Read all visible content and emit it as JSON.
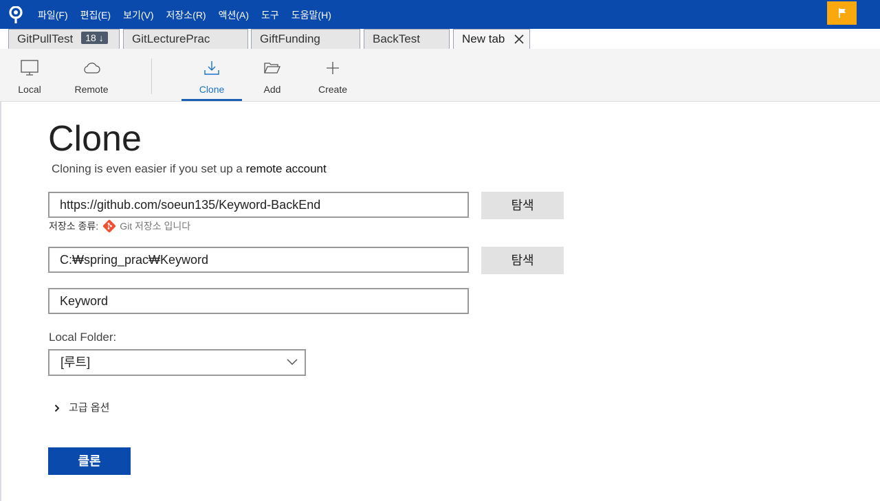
{
  "menu": {
    "items": [
      "파일(F)",
      "편집(E)",
      "보기(V)",
      "저장소(R)",
      "액션(A)",
      "도구",
      "도움말(H)"
    ]
  },
  "tabs": [
    {
      "label": "GitPullTest",
      "badge": "18 ↓"
    },
    {
      "label": "GitLecturePrac"
    },
    {
      "label": "GiftFunding"
    },
    {
      "label": "BackTest"
    },
    {
      "label": "New tab",
      "active": true
    }
  ],
  "toolbar": {
    "local": "Local",
    "remote": "Remote",
    "clone": "Clone",
    "add": "Add",
    "create": "Create"
  },
  "clone": {
    "title": "Clone",
    "subtitle_prefix": "Cloning is even easier if you set up a ",
    "subtitle_link": "remote account",
    "source_url": "https://github.com/soeun135/Keyword-BackEnd",
    "browse_label": "탐색",
    "repo_type_label": "저장소 종류:",
    "repo_type_value": "Git 저장소 입니다",
    "dest_path": "C:₩spring_prac₩Keyword",
    "name": "Keyword",
    "local_folder_label": "Local Folder:",
    "local_folder_value": "[루트]",
    "advanced_label": "고급 옵션",
    "clone_button": "클론"
  },
  "colors": {
    "menubar": "#0b4aad",
    "accent": "#1a5fb4",
    "flag": "#f9a80d",
    "git": "#f05032"
  }
}
